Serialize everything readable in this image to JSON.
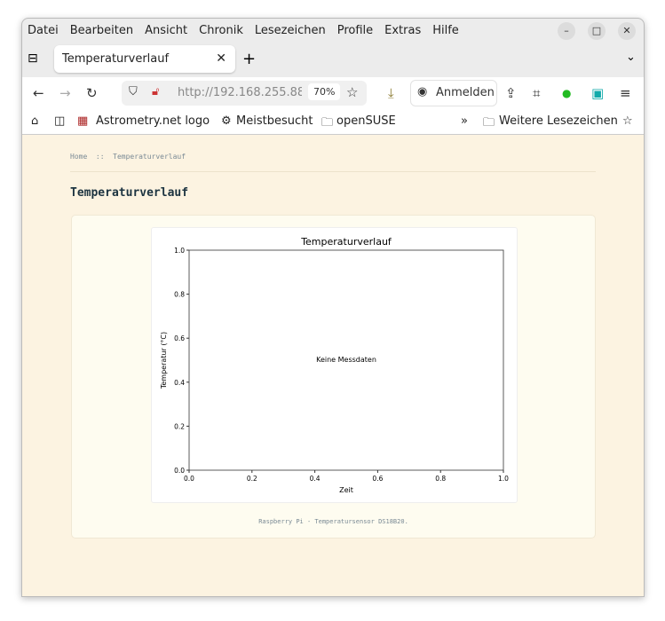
{
  "menu": [
    "Datei",
    "Bearbeiten",
    "Ansicht",
    "Chronik",
    "Lesezeichen",
    "Profile",
    "Extras",
    "Hilfe"
  ],
  "tab": {
    "title": "Temperaturverlauf"
  },
  "nav": {
    "url": "http://192.168.255.88",
    "zoom": "70%",
    "signin": "Anmelden"
  },
  "bookmarks": {
    "items": [
      "Astrometry.net logo",
      "Meistbesucht",
      "openSUSE"
    ],
    "more": "Weitere Lesezeichen"
  },
  "page": {
    "breadcrumb": "Home  ::  Temperaturverlauf",
    "heading": "Temperaturverlauf",
    "footer": "Raspberry Pi - Temperatursensor DS18B20."
  },
  "chart_data": {
    "type": "line",
    "title": "Temperaturverlauf",
    "xlabel": "Zeit",
    "ylabel": "Temperatur (°C)",
    "xlim": [
      0,
      1
    ],
    "ylim": [
      0,
      1
    ],
    "xticks": [
      "0.0",
      "0.2",
      "0.4",
      "0.6",
      "0.8",
      "1.0"
    ],
    "yticks": [
      "0.0",
      "0.2",
      "0.4",
      "0.6",
      "0.8",
      "1.0"
    ],
    "annotation": "Keine Messdaten",
    "series": []
  }
}
